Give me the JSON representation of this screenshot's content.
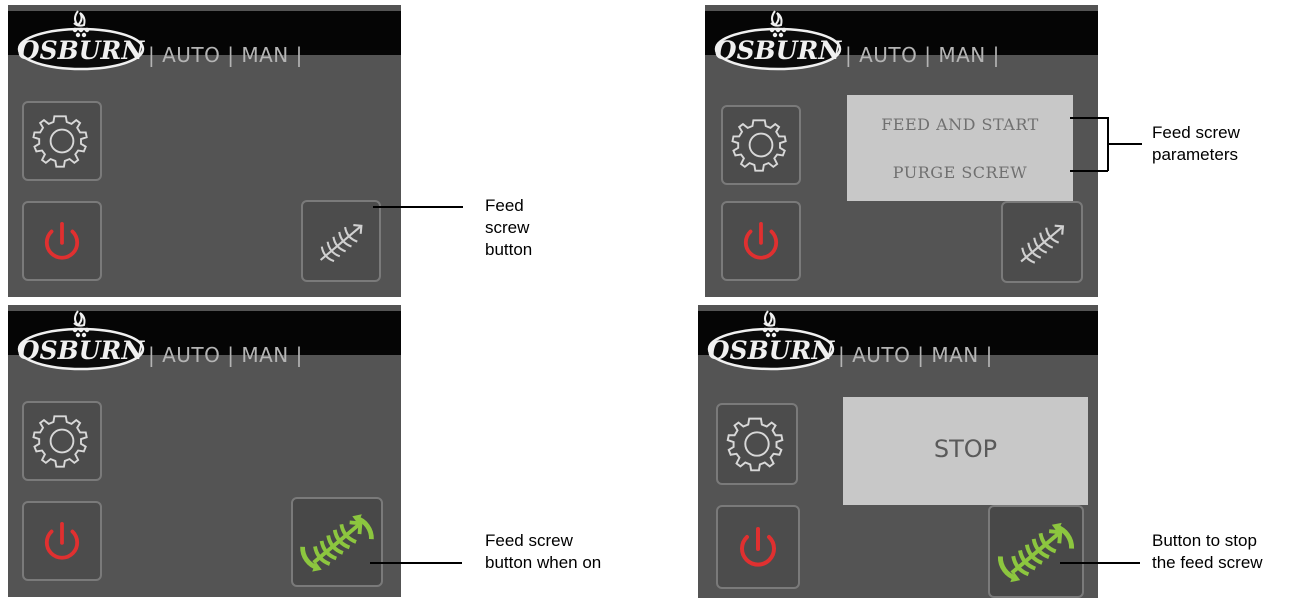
{
  "brand": {
    "logo_text": "OSBURN"
  },
  "mode_label": "| AUTO | MAN |",
  "panels": {
    "top_left": {
      "callout": [
        "Feed",
        "screw",
        "button"
      ]
    },
    "top_right": {
      "popup_items": [
        "FEED AND START",
        "PURGE SCREW"
      ],
      "callout": [
        "Feed screw",
        "parameters"
      ]
    },
    "bottom_left": {
      "callout": [
        "Feed screw",
        "button when on"
      ]
    },
    "bottom_right": {
      "popup_items": [
        "STOP"
      ],
      "callout": [
        "Button to stop",
        "the feed screw"
      ]
    }
  },
  "icons": [
    "osburn-logo-icon",
    "gear-icon",
    "power-icon",
    "feed-screw-icon",
    "feed-screw-active-icon"
  ],
  "colors": {
    "panel_bg": "#545454",
    "header_bg": "#050505",
    "power_red": "#e03030",
    "active_green": "#8cc63f",
    "popup_bg": "#c8c8c8"
  }
}
